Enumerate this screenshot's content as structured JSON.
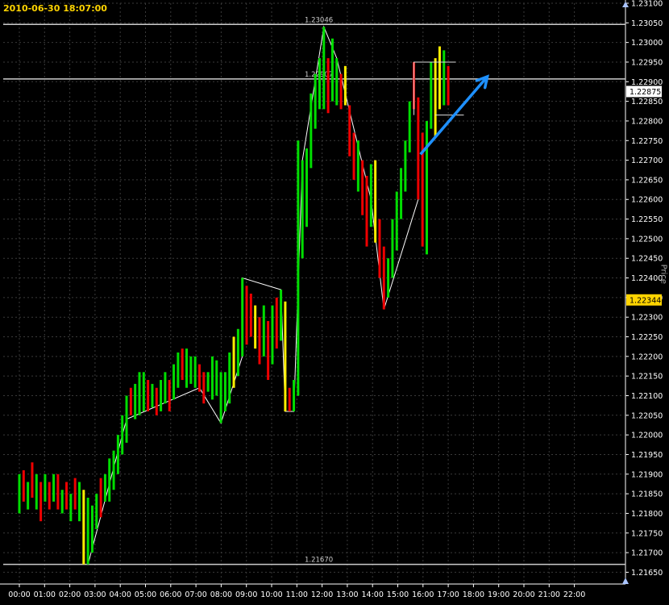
{
  "header": {
    "timestamp": "2010-06-30  18:07:00"
  },
  "axis_title": "Price",
  "colors": {
    "background": "#000000",
    "grid": "#3a3a3a",
    "axis_text": "#ffffff",
    "up_bar": "#00dd00",
    "down_bar": "#ee0000",
    "neutral_bar": "#ffee00",
    "swing_line": "#ffffff",
    "arrow": "#1e90ff",
    "current_price_bg": "#ffffff",
    "reference_price_bg": "#ffd400"
  },
  "chart_data": {
    "type": "ohlc-bar",
    "ylim": [
      1.2162,
      1.231
    ],
    "y_ticks": [
      "1.21650",
      "1.21700",
      "1.21750",
      "1.21800",
      "1.21850",
      "1.21900",
      "1.21950",
      "1.22000",
      "1.22050",
      "1.22100",
      "1.22150",
      "1.22200",
      "1.22250",
      "1.22300",
      "1.22350",
      "1.22400",
      "1.22450",
      "1.22500",
      "1.22550",
      "1.22600",
      "1.22650",
      "1.22700",
      "1.22750",
      "1.22800",
      "1.22850",
      "1.22900",
      "1.22950",
      "1.23000",
      "1.23050",
      "1.23100"
    ],
    "x_ticks": [
      "00:00",
      "01:00",
      "02:00",
      "03:00",
      "04:00",
      "05:00",
      "06:00",
      "07:00",
      "08:00",
      "09:00",
      "10:00",
      "11:00",
      "12:00",
      "13:00",
      "14:00",
      "15:00",
      "16:00",
      "17:00",
      "18:00",
      "19:00",
      "20:00",
      "21:00",
      "22:00"
    ],
    "horizontal_levels": [
      {
        "label": "1.23046",
        "value": 1.23046
      },
      {
        "label": "1.22907",
        "value": 1.22907
      },
      {
        "label": "1.21670",
        "value": 1.2167
      }
    ],
    "price_labels": [
      {
        "label": "1.22875",
        "value": 1.22875,
        "style": "current"
      },
      {
        "label": "1.22344",
        "value": 1.22344,
        "style": "reference"
      }
    ],
    "bars": [
      {
        "t": 0.0,
        "h": 1.219,
        "l": 1.218,
        "c": "up"
      },
      {
        "t": 0.17,
        "h": 1.2191,
        "l": 1.2183,
        "c": "down"
      },
      {
        "t": 0.34,
        "h": 1.2188,
        "l": 1.2181,
        "c": "up"
      },
      {
        "t": 0.51,
        "h": 1.2193,
        "l": 1.2184,
        "c": "down"
      },
      {
        "t": 0.68,
        "h": 1.219,
        "l": 1.2181,
        "c": "up"
      },
      {
        "t": 0.85,
        "h": 1.2188,
        "l": 1.2178,
        "c": "down"
      },
      {
        "t": 1.02,
        "h": 1.219,
        "l": 1.2183,
        "c": "up"
      },
      {
        "t": 1.19,
        "h": 1.2188,
        "l": 1.2181,
        "c": "down"
      },
      {
        "t": 1.36,
        "h": 1.219,
        "l": 1.2183,
        "c": "up"
      },
      {
        "t": 1.53,
        "h": 1.219,
        "l": 1.2181,
        "c": "down"
      },
      {
        "t": 1.7,
        "h": 1.2186,
        "l": 1.218,
        "c": "up"
      },
      {
        "t": 1.87,
        "h": 1.2188,
        "l": 1.2181,
        "c": "down"
      },
      {
        "t": 2.04,
        "h": 1.2185,
        "l": 1.2178,
        "c": "up"
      },
      {
        "t": 2.21,
        "h": 1.2189,
        "l": 1.2181,
        "c": "down"
      },
      {
        "t": 2.38,
        "h": 1.2188,
        "l": 1.2178,
        "c": "up"
      },
      {
        "t": 2.55,
        "h": 1.2186,
        "l": 1.2167,
        "c": "neutral"
      },
      {
        "t": 2.72,
        "h": 1.2184,
        "l": 1.2167,
        "c": "up"
      },
      {
        "t": 2.89,
        "h": 1.2182,
        "l": 1.217,
        "c": "up"
      },
      {
        "t": 3.06,
        "h": 1.2185,
        "l": 1.2176,
        "c": "up"
      },
      {
        "t": 3.23,
        "h": 1.2189,
        "l": 1.2179,
        "c": "down"
      },
      {
        "t": 3.4,
        "h": 1.219,
        "l": 1.2183,
        "c": "up"
      },
      {
        "t": 3.57,
        "h": 1.2194,
        "l": 1.2183,
        "c": "up"
      },
      {
        "t": 3.74,
        "h": 1.2196,
        "l": 1.2186,
        "c": "up"
      },
      {
        "t": 3.91,
        "h": 1.22,
        "l": 1.219,
        "c": "up"
      },
      {
        "t": 4.08,
        "h": 1.2205,
        "l": 1.2195,
        "c": "up"
      },
      {
        "t": 4.25,
        "h": 1.221,
        "l": 1.2198,
        "c": "up"
      },
      {
        "t": 4.42,
        "h": 1.2212,
        "l": 1.2205,
        "c": "down"
      },
      {
        "t": 4.59,
        "h": 1.2213,
        "l": 1.2204,
        "c": "up"
      },
      {
        "t": 4.76,
        "h": 1.2216,
        "l": 1.2205,
        "c": "up"
      },
      {
        "t": 4.93,
        "h": 1.2216,
        "l": 1.2206,
        "c": "up"
      },
      {
        "t": 5.1,
        "h": 1.2214,
        "l": 1.2206,
        "c": "down"
      },
      {
        "t": 5.27,
        "h": 1.2213,
        "l": 1.2207,
        "c": "up"
      },
      {
        "t": 5.44,
        "h": 1.2212,
        "l": 1.2205,
        "c": "down"
      },
      {
        "t": 5.61,
        "h": 1.2214,
        "l": 1.2206,
        "c": "up"
      },
      {
        "t": 5.78,
        "h": 1.2216,
        "l": 1.2208,
        "c": "up"
      },
      {
        "t": 5.95,
        "h": 1.2214,
        "l": 1.2206,
        "c": "down"
      },
      {
        "t": 6.12,
        "h": 1.2218,
        "l": 1.2209,
        "c": "up"
      },
      {
        "t": 6.29,
        "h": 1.2221,
        "l": 1.2212,
        "c": "up"
      },
      {
        "t": 6.46,
        "h": 1.2222,
        "l": 1.2214,
        "c": "down"
      },
      {
        "t": 6.63,
        "h": 1.2222,
        "l": 1.2212,
        "c": "up"
      },
      {
        "t": 6.8,
        "h": 1.222,
        "l": 1.2213,
        "c": "up"
      },
      {
        "t": 6.97,
        "h": 1.222,
        "l": 1.2212,
        "c": "up"
      },
      {
        "t": 7.14,
        "h": 1.2218,
        "l": 1.2211,
        "c": "down"
      },
      {
        "t": 7.31,
        "h": 1.2216,
        "l": 1.2208,
        "c": "down"
      },
      {
        "t": 7.48,
        "h": 1.2216,
        "l": 1.2211,
        "c": "up"
      },
      {
        "t": 7.65,
        "h": 1.222,
        "l": 1.2209,
        "c": "up"
      },
      {
        "t": 7.82,
        "h": 1.2219,
        "l": 1.221,
        "c": "up"
      },
      {
        "t": 7.99,
        "h": 1.2216,
        "l": 1.2203,
        "c": "up"
      },
      {
        "t": 8.16,
        "h": 1.2216,
        "l": 1.2206,
        "c": "up"
      },
      {
        "t": 8.33,
        "h": 1.2221,
        "l": 1.2208,
        "c": "up"
      },
      {
        "t": 8.5,
        "h": 1.2225,
        "l": 1.2212,
        "c": "neutral"
      },
      {
        "t": 8.67,
        "h": 1.2227,
        "l": 1.2215,
        "c": "up"
      },
      {
        "t": 8.84,
        "h": 1.224,
        "l": 1.222,
        "c": "up"
      },
      {
        "t": 9.01,
        "h": 1.2238,
        "l": 1.2223,
        "c": "down"
      },
      {
        "t": 9.18,
        "h": 1.2236,
        "l": 1.2225,
        "c": "down"
      },
      {
        "t": 9.35,
        "h": 1.2233,
        "l": 1.2222,
        "c": "neutral"
      },
      {
        "t": 9.52,
        "h": 1.223,
        "l": 1.2218,
        "c": "down"
      },
      {
        "t": 9.69,
        "h": 1.2233,
        "l": 1.222,
        "c": "up"
      },
      {
        "t": 9.86,
        "h": 1.2229,
        "l": 1.2214,
        "c": "down"
      },
      {
        "t": 10.03,
        "h": 1.2233,
        "l": 1.2218,
        "c": "up"
      },
      {
        "t": 10.2,
        "h": 1.2235,
        "l": 1.2222,
        "c": "down"
      },
      {
        "t": 10.37,
        "h": 1.2237,
        "l": 1.2224,
        "c": "up"
      },
      {
        "t": 10.54,
        "h": 1.2234,
        "l": 1.2206,
        "c": "neutral"
      },
      {
        "t": 10.71,
        "h": 1.2212,
        "l": 1.2206,
        "c": "down"
      },
      {
        "t": 10.88,
        "h": 1.2214,
        "l": 1.2206,
        "c": "up"
      },
      {
        "t": 11.05,
        "h": 1.2275,
        "l": 1.221,
        "c": "up"
      },
      {
        "t": 11.22,
        "h": 1.227,
        "l": 1.2245,
        "c": "up"
      },
      {
        "t": 11.39,
        "h": 1.2273,
        "l": 1.2253,
        "c": "up"
      },
      {
        "t": 11.56,
        "h": 1.2287,
        "l": 1.2268,
        "c": "up"
      },
      {
        "t": 11.73,
        "h": 1.2292,
        "l": 1.2278,
        "c": "up"
      },
      {
        "t": 11.9,
        "h": 1.2296,
        "l": 1.2283,
        "c": "up"
      },
      {
        "t": 12.07,
        "h": 1.2304,
        "l": 1.2283,
        "c": "up"
      },
      {
        "t": 12.24,
        "h": 1.2296,
        "l": 1.2282,
        "c": "down"
      },
      {
        "t": 12.41,
        "h": 1.2301,
        "l": 1.2285,
        "c": "up"
      },
      {
        "t": 12.58,
        "h": 1.2296,
        "l": 1.2284,
        "c": "up"
      },
      {
        "t": 12.75,
        "h": 1.2292,
        "l": 1.2283,
        "c": "down"
      },
      {
        "t": 12.92,
        "h": 1.2294,
        "l": 1.2284,
        "c": "neutral"
      },
      {
        "t": 13.09,
        "h": 1.2284,
        "l": 1.2271,
        "c": "down"
      },
      {
        "t": 13.26,
        "h": 1.2277,
        "l": 1.2265,
        "c": "down"
      },
      {
        "t": 13.43,
        "h": 1.2275,
        "l": 1.2262,
        "c": "up"
      },
      {
        "t": 13.6,
        "h": 1.227,
        "l": 1.2256,
        "c": "down"
      },
      {
        "t": 13.77,
        "h": 1.2266,
        "l": 1.2248,
        "c": "down"
      },
      {
        "t": 13.94,
        "h": 1.2269,
        "l": 1.2253,
        "c": "up"
      },
      {
        "t": 14.11,
        "h": 1.227,
        "l": 1.2249,
        "c": "neutral"
      },
      {
        "t": 14.28,
        "h": 1.2255,
        "l": 1.224,
        "c": "down"
      },
      {
        "t": 14.45,
        "h": 1.2248,
        "l": 1.2232,
        "c": "down"
      },
      {
        "t": 14.62,
        "h": 1.2245,
        "l": 1.2235,
        "c": "up"
      },
      {
        "t": 14.79,
        "h": 1.2255,
        "l": 1.224,
        "c": "up"
      },
      {
        "t": 14.96,
        "h": 1.2262,
        "l": 1.2247,
        "c": "up"
      },
      {
        "t": 15.13,
        "h": 1.2268,
        "l": 1.2255,
        "c": "up"
      },
      {
        "t": 15.3,
        "h": 1.2275,
        "l": 1.2262,
        "c": "up"
      },
      {
        "t": 15.47,
        "h": 1.2285,
        "l": 1.2272,
        "c": "up"
      },
      {
        "t": 15.64,
        "h": 1.2295,
        "l": 1.2283,
        "c": "down"
      },
      {
        "t": 15.81,
        "h": 1.2286,
        "l": 1.226,
        "c": "down"
      },
      {
        "t": 15.98,
        "h": 1.2277,
        "l": 1.2248,
        "c": "down"
      },
      {
        "t": 16.15,
        "h": 1.228,
        "l": 1.2246,
        "c": "up"
      },
      {
        "t": 16.32,
        "h": 1.2295,
        "l": 1.2278,
        "c": "up"
      },
      {
        "t": 16.49,
        "h": 1.2296,
        "l": 1.2276,
        "c": "neutral"
      },
      {
        "t": 16.66,
        "h": 1.2299,
        "l": 1.2283,
        "c": "neutral"
      },
      {
        "t": 16.83,
        "h": 1.2298,
        "l": 1.2284,
        "c": "up"
      },
      {
        "t": 17.0,
        "h": 1.2294,
        "l": 1.2284,
        "c": "down"
      }
    ],
    "swing_path": [
      [
        2.72,
        1.2167
      ],
      [
        4.25,
        1.2204
      ],
      [
        7.14,
        1.2212
      ],
      [
        7.99,
        1.2203
      ],
      [
        8.84,
        1.222
      ],
      [
        8.84,
        1.224
      ],
      [
        10.37,
        1.2237
      ],
      [
        10.54,
        1.2206
      ],
      [
        10.88,
        1.2206
      ],
      [
        11.22,
        1.227
      ],
      [
        12.07,
        1.2304
      ],
      [
        12.58,
        1.2296
      ],
      [
        13.94,
        1.226
      ],
      [
        14.45,
        1.2232
      ],
      [
        15.81,
        1.226
      ]
    ],
    "arrow": {
      "from": [
        15.9,
        1.22715
      ],
      "to": [
        18.55,
        1.22913
      ]
    },
    "right_box": {
      "x0": 15.64,
      "x1": 17.3,
      "top": 1.2295,
      "bottom": 1.22815
    }
  }
}
